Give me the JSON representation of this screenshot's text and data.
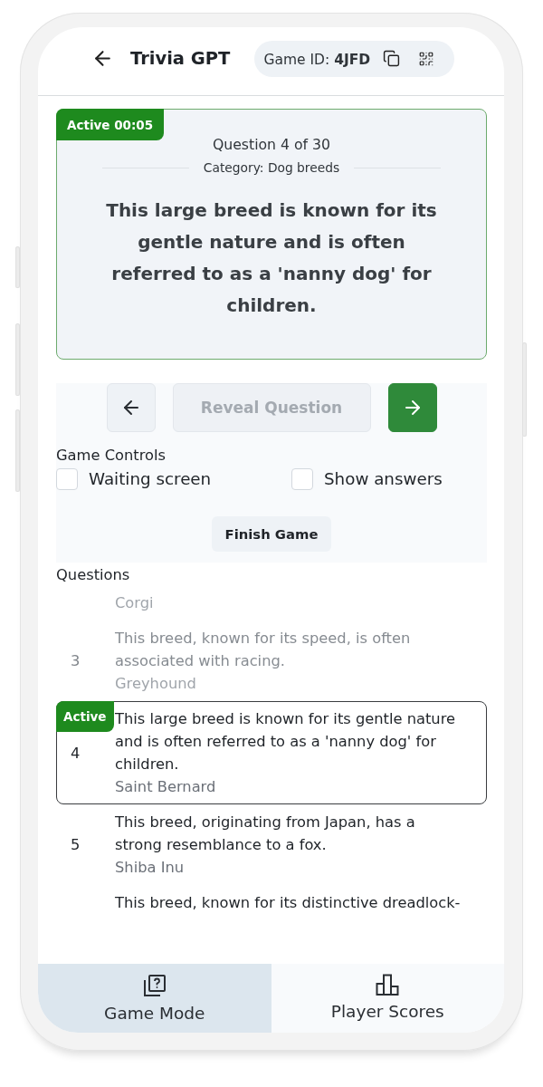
{
  "header": {
    "title": "Trivia GPT",
    "game_id": "Game ID: **4JFD**"
  },
  "question_card": {
    "badge": "Active 00:05",
    "progress": "Question 4 of 30",
    "category": "Category: Dog breeds",
    "text": "This large breed is known for its gentle nature and is often referred to as a 'nanny dog' for children."
  },
  "navigation": {
    "reveal_button": {
      "label": "Reveal Question",
      "disabled": true
    }
  },
  "game_controls": {
    "title": "Game Controls",
    "options": [
      {
        "label": "Waiting screen",
        "checked": false
      },
      {
        "label": "Show answers",
        "checked": false
      }
    ],
    "finish_button": "Finish Game"
  },
  "questions": {
    "title": "Questions",
    "rows": [
      {
        "answer": "Corgi",
        "done": true,
        "selected": false
      },
      {
        "number": "3",
        "question": "This breed, known for its speed, is often associated with racing.",
        "answer": "Greyhound",
        "done": true,
        "selected": false
      },
      {
        "number": "4",
        "badge": "Active",
        "question": "This large breed is known for its gentle nature and is often referred to as a 'nanny dog' for children.",
        "answer": "Saint Bernard",
        "done": false,
        "selected": true
      },
      {
        "number": "5",
        "question": "This breed, originating from Japan, has a strong resemblance to a fox.",
        "answer": "Shiba Inu",
        "done": false,
        "selected": false
      },
      {
        "question": "This breed, known for its distinctive dreadlock-",
        "done": false,
        "selected": false
      }
    ]
  },
  "bottom_nav": [
    {
      "label": "Game Mode",
      "selected": true
    },
    {
      "label": "Player Scores",
      "selected": false
    }
  ]
}
